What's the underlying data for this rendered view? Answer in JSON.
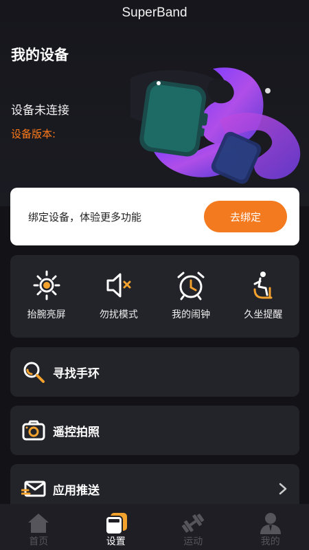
{
  "app": {
    "title": "SuperBand"
  },
  "device": {
    "section_title": "我的设备",
    "status": "设备未连接",
    "version_label": "设备版本:"
  },
  "bind_card": {
    "text": "绑定设备，体验更多功能",
    "button_label": "去绑定"
  },
  "features": [
    {
      "label": "抬腕亮屏",
      "icon": "watch-raise-icon"
    },
    {
      "label": "勿扰模式",
      "icon": "mute-icon"
    },
    {
      "label": "我的闹钟",
      "icon": "alarm-clock-icon"
    },
    {
      "label": "久坐提醒",
      "icon": "sedentary-icon"
    }
  ],
  "menu_rows": [
    {
      "label": "寻找手环",
      "icon": "search-icon"
    },
    {
      "label": "遥控拍照",
      "icon": "camera-icon"
    },
    {
      "label": "应用推送",
      "icon": "message-icon"
    }
  ],
  "tabs": [
    {
      "label": "首页",
      "icon": "home-icon",
      "active": false
    },
    {
      "label": "设置",
      "icon": "settings-icon",
      "active": true
    },
    {
      "label": "运动",
      "icon": "dumbbell-icon",
      "active": false
    },
    {
      "label": "我的",
      "icon": "profile-icon",
      "active": false
    }
  ],
  "colors": {
    "accent": "#f47a1f",
    "background": "#121217",
    "card": "#23232a",
    "white_card": "#ffffff"
  }
}
